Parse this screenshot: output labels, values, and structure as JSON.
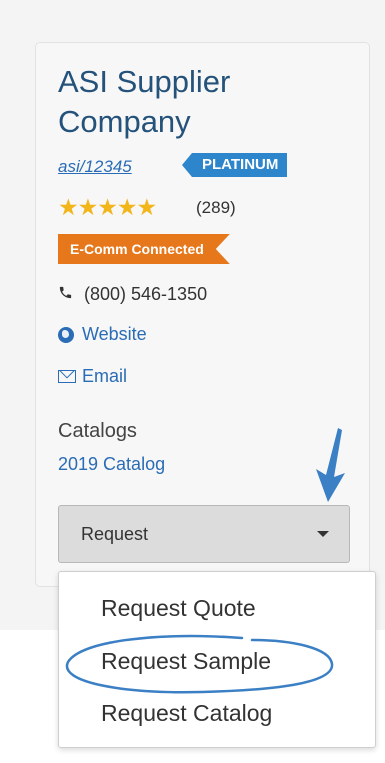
{
  "supplier": {
    "name": "ASI Supplier Company",
    "asi_number": "asi/12345",
    "tier_badge": "PLATINUM",
    "stars": "★★★★★",
    "rating_count": "(289)",
    "ecomm_badge": "E-Comm Connected",
    "phone": "(800) 546-1350",
    "website_label": "Website",
    "email_label": "Email"
  },
  "catalogs": {
    "heading": "Catalogs",
    "items": [
      "2019 Catalog"
    ]
  },
  "request": {
    "button_label": "Request",
    "menu_items": [
      "Request Quote",
      "Request Sample",
      "Request Catalog"
    ]
  },
  "icons": {
    "phone": "phone-icon",
    "website": "globe-icon",
    "email": "mail-icon",
    "dropdown": "caret-down-icon"
  },
  "colors": {
    "title": "#24527a",
    "link": "#2a6cb5",
    "platinum_badge": "#2d86cc",
    "ecomm_badge": "#e6781b",
    "stars": "#f2b51a",
    "annotation": "#3b7fc4"
  }
}
